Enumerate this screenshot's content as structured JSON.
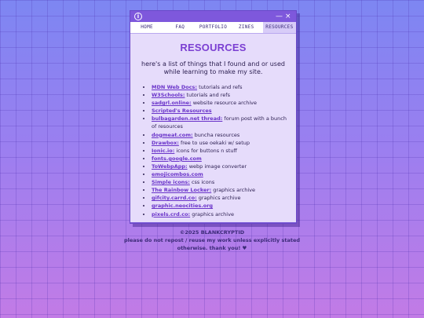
{
  "window": {
    "tabs": [
      {
        "label": "HOME"
      },
      {
        "label": "FAQ"
      },
      {
        "label": "PORTFOLIO"
      },
      {
        "label": "ZINES"
      },
      {
        "label": "RESOURCES"
      }
    ],
    "controls": {
      "minimize": "—",
      "close": "×"
    }
  },
  "page": {
    "title": "RESOURCES",
    "intro": "here's a list of things that I found and or used while learning to make my site."
  },
  "resources": [
    {
      "link": "MDN Web Docs:",
      "desc": " tutorials and refs"
    },
    {
      "link": "W3Schools:",
      "desc": " tutorials and refs"
    },
    {
      "link": "sadgrl.online:",
      "desc": " website resource archive"
    },
    {
      "link": "Scripted's Resources",
      "desc": ""
    },
    {
      "link": "bulbagarden.net thread:",
      "desc": " forum post with a bunch of resources"
    },
    {
      "link": "dogmeat.com:",
      "desc": " buncha resources"
    },
    {
      "link": "Drawbox:",
      "desc": " free to use oekaki w/ setup"
    },
    {
      "link": "Ionic.io:",
      "desc": " icons for buttons n stuff"
    },
    {
      "link": "fonts.google.com",
      "desc": ""
    },
    {
      "link": "ToWebpApp:",
      "desc": " webp image converter"
    },
    {
      "link": "emojicombos.com",
      "desc": ""
    },
    {
      "link": "Simple icons:",
      "desc": " css icons"
    },
    {
      "link": "The Rainbow Locker:",
      "desc": " graphics archive"
    },
    {
      "link": "gifcity.carrd.co:",
      "desc": " graphics archive"
    },
    {
      "link": "graphic.neocities.org",
      "desc": ""
    },
    {
      "link": "pixels.crd.co:",
      "desc": " graphics archive"
    }
  ],
  "footer": {
    "copyright": "©2025 BLANKCRYPTID",
    "notice": "please do not repost / reuse my work unless explicitly stated otherwise. thank you! ♥"
  }
}
